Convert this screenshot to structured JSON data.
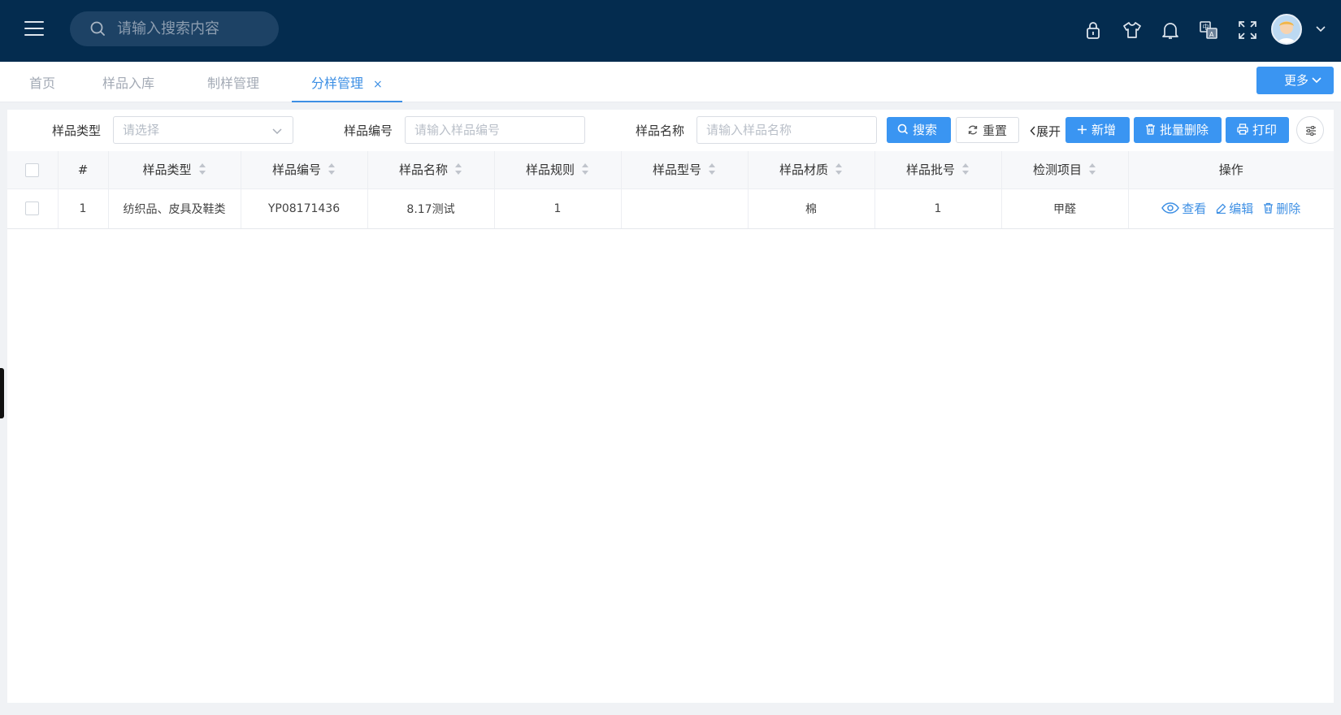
{
  "header": {
    "search_placeholder": "请输入搜索内容",
    "icons": [
      "lock-icon",
      "shirt-icon",
      "bell-icon",
      "translate-icon",
      "fullscreen-icon"
    ]
  },
  "tabs": [
    {
      "label": "首页",
      "active": false
    },
    {
      "label": "样品入库",
      "active": false
    },
    {
      "label": "制样管理",
      "active": false
    },
    {
      "label": "分样管理",
      "active": true,
      "close": "×"
    }
  ],
  "more_button": "更多",
  "filters": {
    "type_label": "样品类型",
    "type_placeholder": "请选择",
    "code_label": "样品编号",
    "code_placeholder": "请输入样品编号",
    "name_label": "样品名称",
    "name_placeholder": "请输入样品名称"
  },
  "buttons": {
    "search": "搜索",
    "reset": "重置",
    "expand": "展开",
    "add": "新增",
    "batch_delete": "批量删除",
    "print": "打印"
  },
  "table": {
    "columns": [
      "#",
      "样品类型",
      "样品编号",
      "样品名称",
      "样品规则",
      "样品型号",
      "样品材质",
      "样品批号",
      "检测项目",
      "操作"
    ],
    "rows": [
      {
        "index": "1",
        "type": "纺织品、皮具及鞋类",
        "code": "YP08171436",
        "name": "8.17测试",
        "rule": "1",
        "model": "",
        "material": "棉",
        "batch": "1",
        "item": "甲醛"
      }
    ],
    "actions": {
      "view": "查看",
      "edit": "编辑",
      "delete": "删除"
    }
  },
  "colors": {
    "header_bg": "#042c4f",
    "primary": "#3a95f2",
    "link": "#3d8fe4"
  }
}
